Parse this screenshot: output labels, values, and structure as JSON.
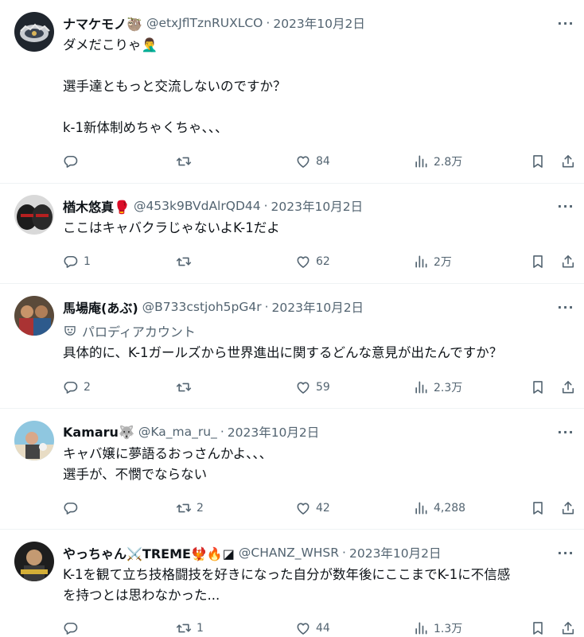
{
  "tweets": [
    {
      "name": "ナマケモノ🦥",
      "handle": "@etxJflTznRUXLCO",
      "date": "2023年10月2日",
      "lines": [
        "ダメだこりゃ🤦‍♂️",
        "",
        "選手達ともっと交流しないのですか？",
        "",
        "k-1新体制めちゃくちゃ、、、"
      ],
      "parody": "",
      "replies": "",
      "retweets": "",
      "likes": "84",
      "views": "2.8万"
    },
    {
      "name": "楢木悠真🥊",
      "handle": "@453k9BVdAlrQD44",
      "date": "2023年10月2日",
      "lines": [
        "ここはキャバクラじゃないよK-1だよ"
      ],
      "parody": "",
      "replies": "1",
      "retweets": "",
      "likes": "62",
      "views": "2万"
    },
    {
      "name": "馬場庵(あぶ)",
      "handle": "@B733cstjoh5pG4r",
      "date": "2023年10月2日",
      "lines": [
        "具体的に、K-1ガールズから世界進出に関するどんな意見が出たんですか？"
      ],
      "parody": "パロディアカウント",
      "replies": "2",
      "retweets": "",
      "likes": "59",
      "views": "2.3万"
    },
    {
      "name": "Kamaru🐺",
      "handle": "@Ka_ma_ru_",
      "date": "2023年10月2日",
      "lines": [
        "キャバ嬢に夢語るおっさんかよ、、、",
        "選手が、不憫でならない"
      ],
      "parody": "",
      "replies": "",
      "retweets": "2",
      "likes": "42",
      "views": "4,288"
    },
    {
      "name": "やっちゃん⚔️TREME🐦‍🔥🔥◪",
      "handle": "@CHANZ_WHSR",
      "date": "2023年10月2日",
      "lines": [
        "K-1を観て立ち技格闘技を好きになった自分が数年後にここまでK-1に不信感",
        "を持つとは思わなかった..."
      ],
      "parody": "",
      "replies": "",
      "retweets": "1",
      "likes": "44",
      "views": "1.3万"
    }
  ],
  "icons": {
    "more": "more-icon",
    "reply": "reply-icon",
    "retweet": "retweet-icon",
    "like": "like-icon",
    "views": "views-icon",
    "bookmark": "bookmark-icon",
    "share": "share-icon",
    "parody": "parody-mask-icon"
  },
  "colors": {
    "text": "#0f1419",
    "secondary": "#536471",
    "divider": "#eff3f4"
  }
}
